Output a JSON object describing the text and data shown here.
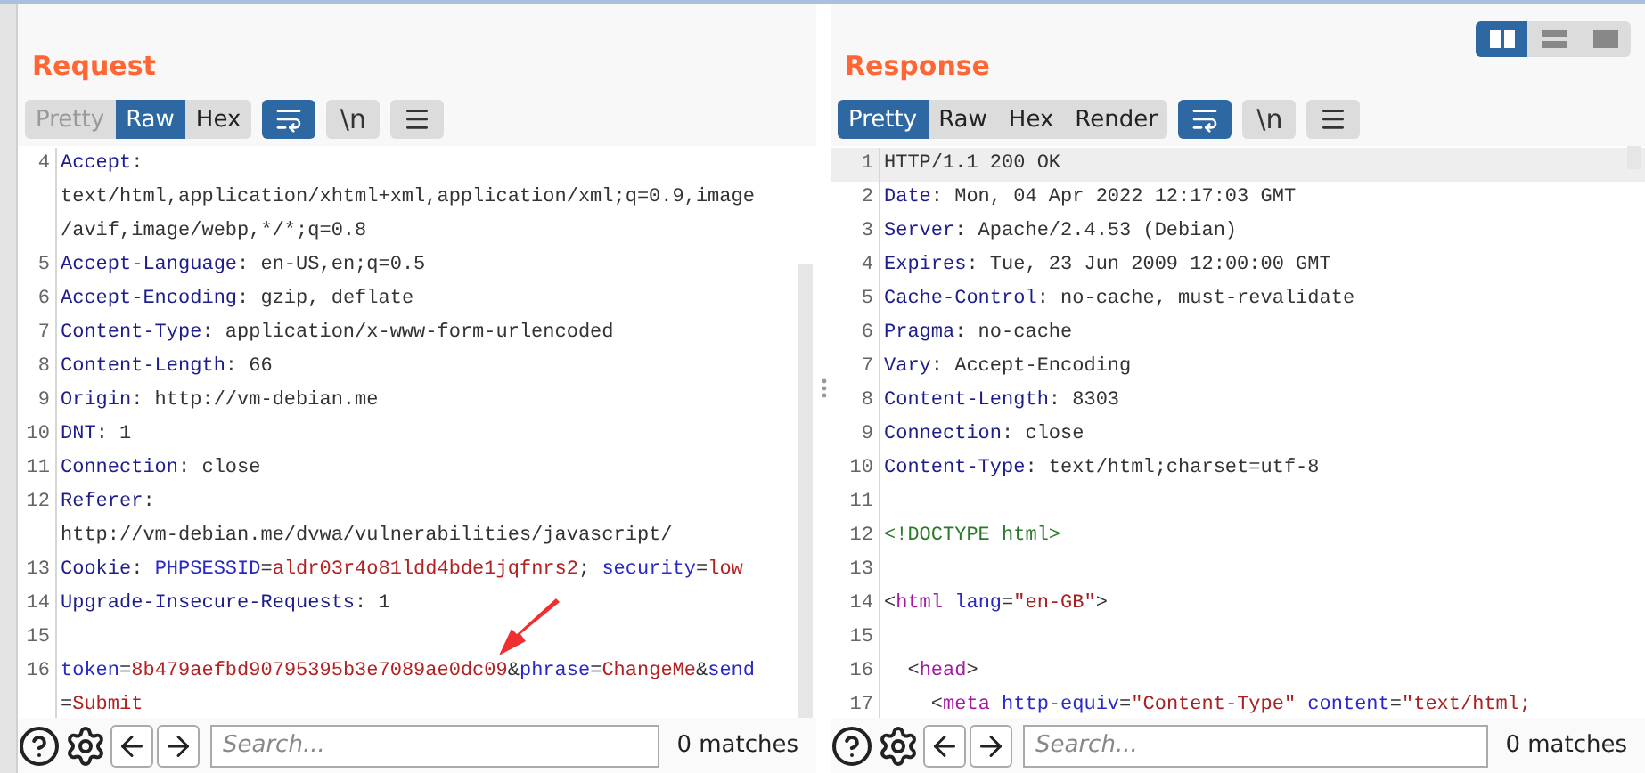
{
  "layout_toggles": [
    {
      "kind": "side-by-side",
      "selected": true
    },
    {
      "kind": "stacked",
      "selected": false
    },
    {
      "kind": "single",
      "selected": false
    }
  ],
  "panes": [
    {
      "title": "Request",
      "view_tabs": [
        {
          "label": "Pretty",
          "selected": false,
          "disabled": true
        },
        {
          "label": "Raw",
          "selected": true,
          "disabled": false
        },
        {
          "label": "Hex",
          "selected": false,
          "disabled": false
        }
      ],
      "tools": [
        {
          "kind": "wrap",
          "selected": true
        },
        {
          "kind": "newline",
          "label": "\\n",
          "selected": false
        },
        {
          "kind": "menu",
          "selected": false
        }
      ],
      "lines": [
        {
          "number": "4",
          "selected": false,
          "rows": [
            [
              {
                "kind": "key",
                "text": "Accept"
              },
              {
                "kind": "plain",
                "text": ":"
              }
            ],
            [
              {
                "kind": "plain",
                "text": "text/html,application/xhtml+xml,application/xml;q=0.9,image"
              }
            ],
            [
              {
                "kind": "plain",
                "text": "/avif,image/webp,*/*;q=0.8"
              }
            ]
          ]
        },
        {
          "number": "5",
          "selected": false,
          "rows": [
            [
              {
                "kind": "key",
                "text": "Accept-Language"
              },
              {
                "kind": "plain",
                "text": ": en-US,en;q=0.5"
              }
            ]
          ]
        },
        {
          "number": "6",
          "selected": false,
          "rows": [
            [
              {
                "kind": "key",
                "text": "Accept-Encoding"
              },
              {
                "kind": "plain",
                "text": ": gzip, deflate"
              }
            ]
          ]
        },
        {
          "number": "7",
          "selected": false,
          "rows": [
            [
              {
                "kind": "key",
                "text": "Content-Type"
              },
              {
                "kind": "plain",
                "text": ": application/x-www-form-urlencoded"
              }
            ]
          ]
        },
        {
          "number": "8",
          "selected": false,
          "rows": [
            [
              {
                "kind": "key",
                "text": "Content-Length"
              },
              {
                "kind": "plain",
                "text": ": 66"
              }
            ]
          ]
        },
        {
          "number": "9",
          "selected": false,
          "rows": [
            [
              {
                "kind": "key",
                "text": "Origin"
              },
              {
                "kind": "plain",
                "text": ": http://vm-debian.me"
              }
            ]
          ]
        },
        {
          "number": "10",
          "selected": false,
          "rows": [
            [
              {
                "kind": "key",
                "text": "DNT"
              },
              {
                "kind": "plain",
                "text": ": 1"
              }
            ]
          ]
        },
        {
          "number": "11",
          "selected": false,
          "rows": [
            [
              {
                "kind": "key",
                "text": "Connection"
              },
              {
                "kind": "plain",
                "text": ": close"
              }
            ]
          ]
        },
        {
          "number": "12",
          "selected": false,
          "rows": [
            [
              {
                "kind": "key",
                "text": "Referer"
              },
              {
                "kind": "plain",
                "text": ":"
              }
            ],
            [
              {
                "kind": "plain",
                "text": "http://vm-debian.me/dvwa/vulnerabilities/javascript/"
              }
            ]
          ]
        },
        {
          "number": "13",
          "selected": false,
          "rows": [
            [
              {
                "kind": "key",
                "text": "Cookie"
              },
              {
                "kind": "plain",
                "text": ": "
              },
              {
                "kind": "param",
                "text": "PHPSESSID"
              },
              {
                "kind": "plain",
                "text": "="
              },
              {
                "kind": "value",
                "text": "aldr03r4o81ldd4bde1jqfnrs2"
              },
              {
                "kind": "plain",
                "text": "; "
              },
              {
                "kind": "param",
                "text": "security"
              },
              {
                "kind": "plain",
                "text": "="
              },
              {
                "kind": "value",
                "text": "low"
              }
            ]
          ]
        },
        {
          "number": "14",
          "selected": false,
          "rows": [
            [
              {
                "kind": "key",
                "text": "Upgrade-Insecure-Requests"
              },
              {
                "kind": "plain",
                "text": ": 1"
              }
            ]
          ]
        },
        {
          "number": "15",
          "selected": false
        },
        {
          "number": "16",
          "selected": false,
          "rows": [
            [
              {
                "kind": "param",
                "text": "token"
              },
              {
                "kind": "plain",
                "text": "="
              },
              {
                "kind": "value",
                "text": "8b479aefbd90795395b3e7089ae0dc09"
              },
              {
                "kind": "plain",
                "text": "&"
              },
              {
                "kind": "param",
                "text": "phrase"
              },
              {
                "kind": "plain",
                "text": "="
              },
              {
                "kind": "value",
                "text": "ChangeMe"
              },
              {
                "kind": "plain",
                "text": "&"
              },
              {
                "kind": "param",
                "text": "send"
              }
            ],
            [
              {
                "kind": "plain",
                "text": "="
              },
              {
                "kind": "value",
                "text": "Submit"
              }
            ]
          ]
        }
      ],
      "search": {
        "placeholder": "Search..."
      },
      "matches": "0 matches"
    },
    {
      "title": "Response",
      "view_tabs": [
        {
          "label": "Pretty",
          "selected": true,
          "disabled": false
        },
        {
          "label": "Raw",
          "selected": false,
          "disabled": false
        },
        {
          "label": "Hex",
          "selected": false,
          "disabled": false
        },
        {
          "label": "Render",
          "selected": false,
          "disabled": false
        }
      ],
      "tools": [
        {
          "kind": "wrap",
          "selected": true
        },
        {
          "kind": "newline",
          "label": "\\n",
          "selected": false
        },
        {
          "kind": "menu",
          "selected": false
        }
      ],
      "lines": [
        {
          "number": "1",
          "selected": true,
          "rows": [
            [
              {
                "kind": "plain",
                "text": "HTTP/1.1 200 OK"
              }
            ]
          ]
        },
        {
          "number": "2",
          "selected": false,
          "rows": [
            [
              {
                "kind": "key",
                "text": "Date"
              },
              {
                "kind": "plain",
                "text": ": Mon, 04 Apr 2022 12:17:03 GMT"
              }
            ]
          ]
        },
        {
          "number": "3",
          "selected": false,
          "rows": [
            [
              {
                "kind": "key",
                "text": "Server"
              },
              {
                "kind": "plain",
                "text": ": Apache/2.4.53 (Debian)"
              }
            ]
          ]
        },
        {
          "number": "4",
          "selected": false,
          "rows": [
            [
              {
                "kind": "key",
                "text": "Expires"
              },
              {
                "kind": "plain",
                "text": ": Tue, 23 Jun 2009 12:00:00 GMT"
              }
            ]
          ]
        },
        {
          "number": "5",
          "selected": false,
          "rows": [
            [
              {
                "kind": "key",
                "text": "Cache-Control"
              },
              {
                "kind": "plain",
                "text": ": no-cache, must-revalidate"
              }
            ]
          ]
        },
        {
          "number": "6",
          "selected": false,
          "rows": [
            [
              {
                "kind": "key",
                "text": "Pragma"
              },
              {
                "kind": "plain",
                "text": ": no-cache"
              }
            ]
          ]
        },
        {
          "number": "7",
          "selected": false,
          "rows": [
            [
              {
                "kind": "key",
                "text": "Vary"
              },
              {
                "kind": "plain",
                "text": ": Accept-Encoding"
              }
            ]
          ]
        },
        {
          "number": "8",
          "selected": false,
          "rows": [
            [
              {
                "kind": "key",
                "text": "Content-Length"
              },
              {
                "kind": "plain",
                "text": ": 8303"
              }
            ]
          ]
        },
        {
          "number": "9",
          "selected": false,
          "rows": [
            [
              {
                "kind": "key",
                "text": "Connection"
              },
              {
                "kind": "plain",
                "text": ": close"
              }
            ]
          ]
        },
        {
          "number": "10",
          "selected": false,
          "rows": [
            [
              {
                "kind": "key",
                "text": "Content-Type"
              },
              {
                "kind": "plain",
                "text": ": text/html;charset=utf-8"
              }
            ]
          ]
        },
        {
          "number": "11",
          "selected": false
        },
        {
          "number": "12",
          "selected": false,
          "rows": [
            [
              {
                "kind": "doctype",
                "text": "<!DOCTYPE html>"
              }
            ]
          ]
        },
        {
          "number": "13",
          "selected": false
        },
        {
          "number": "14",
          "selected": false,
          "rows": [
            [
              {
                "kind": "plain",
                "text": "<"
              },
              {
                "kind": "tag",
                "text": "html"
              },
              {
                "kind": "attr",
                "text": " lang"
              },
              {
                "kind": "plain",
                "text": "="
              },
              {
                "kind": "string",
                "text": "\"en-GB\""
              },
              {
                "kind": "plain",
                "text": ">"
              }
            ]
          ]
        },
        {
          "number": "15",
          "selected": false
        },
        {
          "number": "16",
          "selected": false,
          "rows": [
            [
              {
                "kind": "plain",
                "text": "  <"
              },
              {
                "kind": "tag",
                "text": "head"
              },
              {
                "kind": "plain",
                "text": ">"
              }
            ]
          ]
        },
        {
          "number": "17",
          "selected": false,
          "rows": [
            [
              {
                "kind": "plain",
                "text": "    <"
              },
              {
                "kind": "tag",
                "text": "meta"
              },
              {
                "kind": "attr",
                "text": " http-equiv"
              },
              {
                "kind": "plain",
                "text": "="
              },
              {
                "kind": "string",
                "text": "\"Content-Type\""
              },
              {
                "kind": "attr",
                "text": " content"
              },
              {
                "kind": "plain",
                "text": "="
              },
              {
                "kind": "string",
                "text": "\"text/html;"
              }
            ]
          ]
        }
      ],
      "search": {
        "placeholder": "Search..."
      },
      "matches": "0 matches"
    }
  ]
}
